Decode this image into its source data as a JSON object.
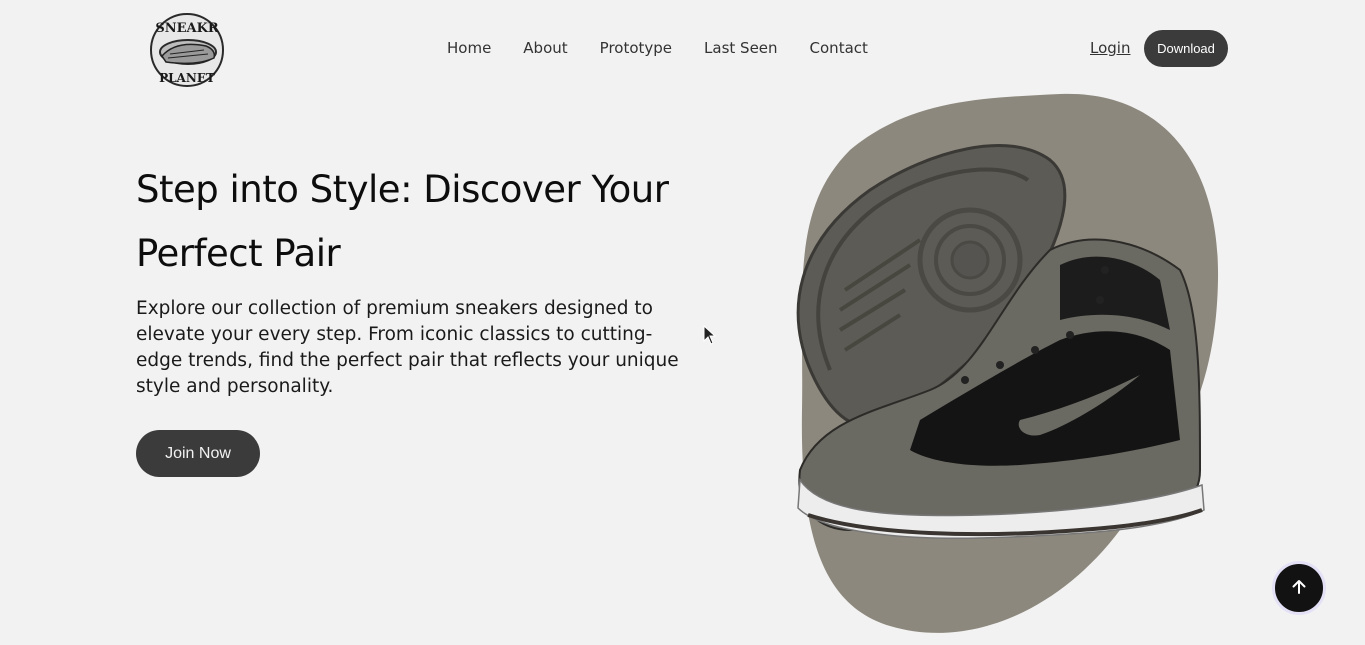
{
  "brand": {
    "logo_text_top": "SNEAKR",
    "logo_text_bottom": "PLANET"
  },
  "nav": {
    "items": [
      {
        "label": "Home"
      },
      {
        "label": "About"
      },
      {
        "label": "Prototype"
      },
      {
        "label": "Last Seen"
      },
      {
        "label": "Contact"
      }
    ]
  },
  "header": {
    "login_label": "Login",
    "download_label": "Download"
  },
  "hero": {
    "headline_line1": "Step into Style: Discover Your",
    "headline_line2": "Perfect Pair",
    "description": "Explore our collection of premium sneakers designed to elevate your every step. From iconic classics to cutting-edge trends, find the perfect pair that reflects your unique style and personality.",
    "cta_label": "Join Now",
    "image_subject": "sneaker-image"
  },
  "colors": {
    "background": "#f2f2f2",
    "button_dark": "#3b3b3b",
    "blob": "#8d887d",
    "scroll_button": "#121212"
  },
  "icons": {
    "scroll_top": "arrow-up-icon"
  }
}
